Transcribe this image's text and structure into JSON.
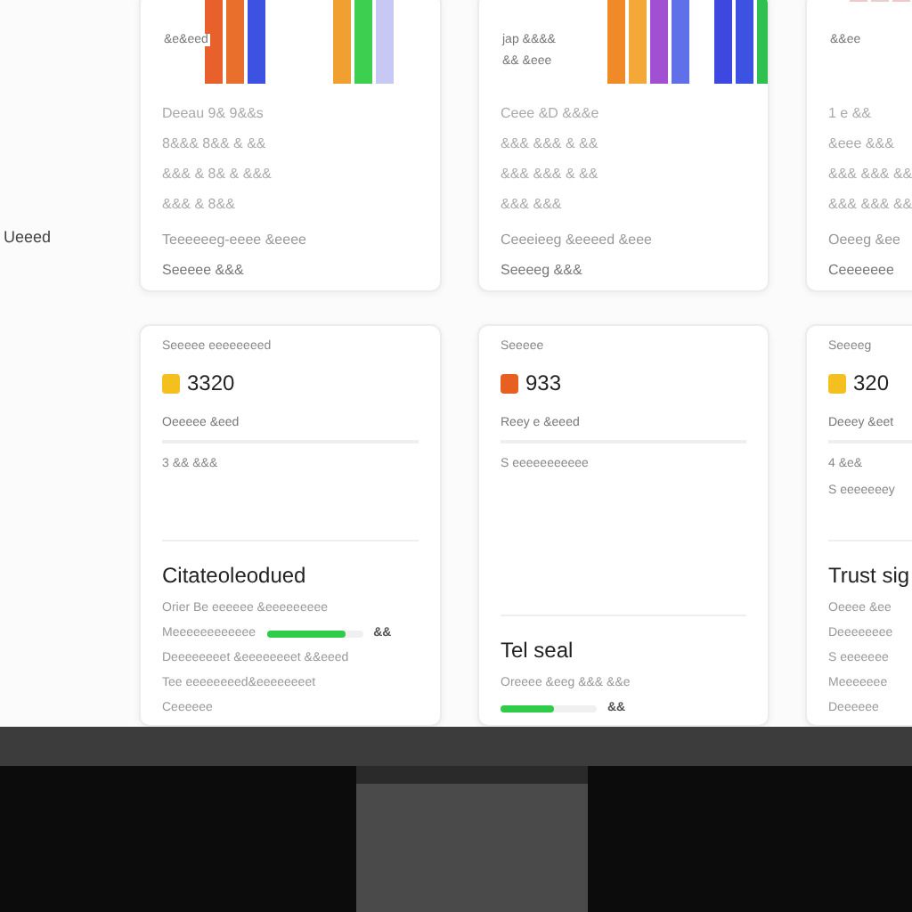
{
  "side_label": "Ueeed",
  "top_cards": [
    {
      "chart_labels": [
        "&e&eed"
      ],
      "lines": [
        "Deeau 9& 9&&s",
        "8&&& 8&& & &&",
        "&&& & 8& & &&&",
        "&&& & 8&&"
      ],
      "footer_title": "Teeeeeeg-eeee &eeee",
      "footer_value": "Seeeee &&&"
    },
    {
      "chart_labels": [
        "jap &&&&",
        "&& &eee"
      ],
      "lines": [
        "Ceee &D &&&e",
        "&&& &&& & &&",
        "&&& &&& & &&",
        "&&& &&&"
      ],
      "footer_title": "Ceeeieeg &eeeed &eee",
      "footer_value": "Seeeeg &&&"
    },
    {
      "chart_labels": [
        "&&ee"
      ],
      "lines": [
        "1 e &&",
        "&eee &&&",
        "&&& &&& &&",
        "&&& &&& &&"
      ],
      "footer_title": "Oeeeg &ee",
      "footer_value": "Ceeeeeee"
    }
  ],
  "bottom_cards": [
    {
      "label": "Seeeee eeeeeeeed",
      "color": "#f4c020",
      "value": "3320",
      "sub_label": "Oeeeee &eed",
      "sub_values": [
        "3 &&  &&&"
      ],
      "title": "Citateoleodued",
      "rows": [
        {
          "kind": "text",
          "text": "Orier Be eeeeee &eeeeeeeee"
        },
        {
          "kind": "bar",
          "text": "Meeeeeeeeeeee",
          "level": 0.82,
          "reading": "&&"
        },
        {
          "kind": "text",
          "text": "Deeeeeeeet &eeeeeeeet &&eeed"
        },
        {
          "kind": "text",
          "text": "Tee eeeeeeeed&eeeeeeeet"
        },
        {
          "kind": "text",
          "text": "Ceeeeee"
        }
      ]
    },
    {
      "label": "Seeeee",
      "color": "#e86020",
      "value": "933",
      "sub_label": "Reey e &eeed",
      "sub_values": [
        "S eeeeeeeeeee"
      ],
      "title": "Tel seal",
      "rows": [
        {
          "kind": "text",
          "text": "Oreeee &eeg &&& &&e"
        },
        {
          "kind": "bar",
          "text": "",
          "level": 0.55,
          "reading": "&&"
        }
      ]
    },
    {
      "label": "Seeeeg",
      "color": "#f4c020",
      "value": "320",
      "sub_label": "Deeey &eet",
      "sub_values": [
        "4 &e&",
        "S eeeeeeey"
      ],
      "title": "Trust sig",
      "rows": [
        {
          "kind": "text",
          "text": "Oeeee &ee"
        },
        {
          "kind": "text",
          "text": "Deeeeeeee"
        },
        {
          "kind": "text",
          "text": "S eeeeeee"
        },
        {
          "kind": "text",
          "text": "Meeeeeee"
        },
        {
          "kind": "text",
          "text": "Deeeeee"
        }
      ]
    }
  ]
}
